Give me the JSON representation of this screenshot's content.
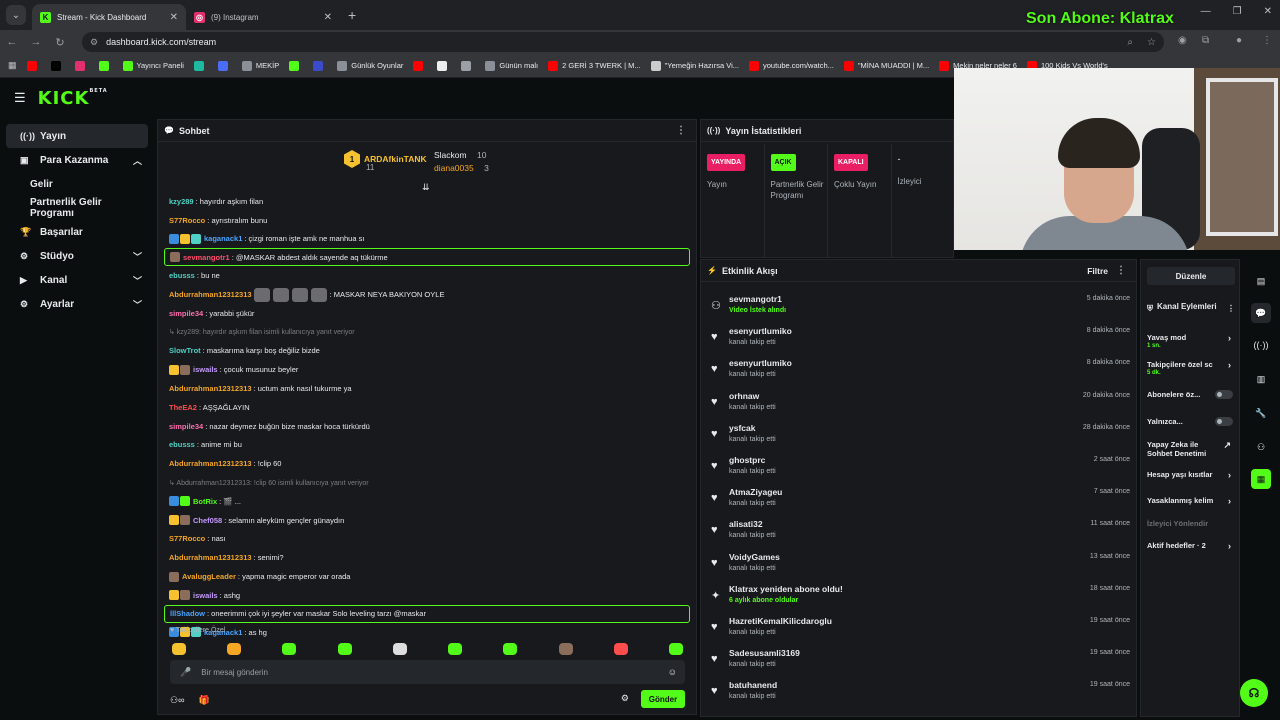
{
  "browser": {
    "tabs": [
      {
        "title": "Stream - Kick Dashboard",
        "icon": "K"
      },
      {
        "title": "(9) Instagram",
        "icon": "◎"
      }
    ],
    "url": "dashboard.kick.com/stream",
    "overlay_text": "Son Abone: Klatrax",
    "bookmarks": [
      {
        "label": "",
        "color": "#ff0000",
        "icon": "youtube-icon"
      },
      {
        "label": "",
        "color": "#000000",
        "icon": "x-icon"
      },
      {
        "label": "",
        "color": "#e1306c",
        "icon": "instagram-icon"
      },
      {
        "label": "",
        "color": "#53fc18",
        "icon": "kick-icon"
      },
      {
        "label": "Yayıncı Paneli",
        "color": "#53fc18",
        "icon": "kick-icon"
      },
      {
        "label": "",
        "color": "#1db9a0",
        "icon": "app-icon"
      },
      {
        "label": "",
        "color": "#4a6cf7",
        "icon": "arrow-icon"
      },
      {
        "label": "MEKİP",
        "color": "#8a8f98",
        "icon": "folder-icon"
      },
      {
        "label": "",
        "color": "#53fc18",
        "icon": "kick-icon"
      },
      {
        "label": "",
        "color": "#3b4cca",
        "icon": "app-icon"
      },
      {
        "label": "Günlük Oyunlar",
        "color": "#8a8f98",
        "icon": "folder-icon"
      },
      {
        "label": "",
        "color": "#ff0000",
        "icon": "youtube-icon"
      },
      {
        "label": "",
        "color": "#eeeeee",
        "icon": "game-icon"
      },
      {
        "label": "",
        "color": "#9aa0a6",
        "icon": "globe-icon"
      },
      {
        "label": "Günün malı",
        "color": "#8a8f98",
        "icon": "folder-icon"
      },
      {
        "label": "2 GERİ 3 TWERK | M...",
        "color": "#ff0000",
        "icon": "youtube-icon"
      },
      {
        "label": "\"Yemeğin Hazırsa Vi...",
        "color": "#cccccc",
        "icon": "globe-icon"
      },
      {
        "label": "youtube.com/watch...",
        "color": "#ff0000",
        "icon": "youtube-icon"
      },
      {
        "label": "\"MİNA MUADDI | M...",
        "color": "#ff0000",
        "icon": "youtube-icon"
      },
      {
        "label": "Mekin neler neler 6",
        "color": "#ff0000",
        "icon": "youtube-icon"
      },
      {
        "label": "100 Kids Vs World's",
        "color": "#ff0000",
        "icon": "youtube-icon"
      }
    ]
  },
  "sidebar": {
    "items": [
      {
        "label": "Yayın",
        "icon": "broadcast-icon",
        "active": true
      },
      {
        "label": "Para Kazanma",
        "icon": "money-icon",
        "expanded": true
      },
      {
        "label": "Gelir",
        "sub": true
      },
      {
        "label": "Partnerlik Gelir Programı",
        "sub": true
      },
      {
        "label": "Başarılar",
        "icon": "trophy-icon"
      },
      {
        "label": "Stüdyo",
        "icon": "studio-icon",
        "chevron": true
      },
      {
        "label": "Kanal",
        "icon": "channel-icon",
        "chevron": true
      },
      {
        "label": "Ayarlar",
        "icon": "settings-icon",
        "chevron": true
      }
    ]
  },
  "chat": {
    "title": "Sohbet",
    "pinned": {
      "top_name": "ARDAfkinTANK",
      "top_count": "11",
      "top_rank": "1",
      "second_name": "Slackom",
      "second_count": "10",
      "third_name": "diana0035",
      "third_count": "3"
    },
    "messages": [
      {
        "user": "kzy289",
        "color": "#4fd1c5",
        "text": ": hayırdır aşkım filan",
        "badges": []
      },
      {
        "user": "S77Rocco",
        "color": "#f5a623",
        "text": ": ayrıstıralım bunu",
        "badges": []
      },
      {
        "user": "kaganack1",
        "color": "#4aa3ff",
        "text": ": çizgi roman işte amk ne manhua sı",
        "badges": [
          "#3a8dde",
          "#f5c12e",
          "#4fd1c5"
        ]
      },
      {
        "user": "sevmangotr1",
        "color": "#ff4d6d",
        "text": ": @MASKAR abdest aldık sayende aq tükürme",
        "badges": [
          "#8a6d5a"
        ],
        "highlight": true
      },
      {
        "user": "ebusss",
        "color": "#4fd1c5",
        "text": ": bu ne",
        "badges": []
      },
      {
        "user": "Abdurrahman12312313",
        "color": "#f5a623",
        "text": ": MASKAR NEYA BAKIYON OYLE",
        "badges": [],
        "emotes": 4
      },
      {
        "user": "simpile34",
        "color": "#ff6fb0",
        "text": ": yarabbi şükür",
        "badges": []
      },
      {
        "user": "",
        "color": "#7a7d80",
        "text": "↳ kzy289: hayırdır aşkım filan isimli kullanıcıya yanıt veriyor",
        "badges": [],
        "reply": true
      },
      {
        "user": "SlowTrot",
        "color": "#4fd1c5",
        "text": ": maskarıma karşı boş değiliz bizde",
        "badges": []
      },
      {
        "user": "iswails",
        "color": "#c59aff",
        "text": ": çocuk musunuz beyler",
        "badges": [
          "#f5c12e",
          "#8a6d5a"
        ]
      },
      {
        "user": "Abdurrahman12312313",
        "color": "#f5a623",
        "text": ": uctum amk nasıl tukurme ya",
        "badges": []
      },
      {
        "user": "TheEA2",
        "color": "#ff4d4d",
        "text": ": AŞŞAĞLAYIN",
        "badges": []
      },
      {
        "user": "simpile34",
        "color": "#ff6fb0",
        "text": ": nazar deymez buğün bize maskar hoca türkürdü",
        "badges": []
      },
      {
        "user": "ebusss",
        "color": "#4fd1c5",
        "text": ": anime mi bu",
        "badges": []
      },
      {
        "user": "Abdurrahman12312313",
        "color": "#f5a623",
        "text": ": !clip 60",
        "badges": []
      },
      {
        "user": "",
        "color": "#7a7d80",
        "text": "↳ Abdurrahman12312313: !clip 60 isimli kullanıcıya yanıt veriyor",
        "badges": [],
        "reply": true
      },
      {
        "user": "BotRix",
        "color": "#53fc18",
        "text": ": 🎬 ...",
        "badges": [
          "#3a8dde",
          "#53fc18"
        ]
      },
      {
        "user": "Chef058",
        "color": "#c59aff",
        "text": ": selamın aleyküm gençler günaydın",
        "badges": [
          "#f5c12e",
          "#8a6d5a"
        ]
      },
      {
        "user": "S77Rocco",
        "color": "#f5a623",
        "text": ": nası",
        "badges": []
      },
      {
        "user": "Abdurrahman12312313",
        "color": "#f5a623",
        "text": ": senimi?",
        "badges": []
      },
      {
        "user": "AvaluggLeader",
        "color": "#f5a623",
        "text": ": yapma magic emperor var orada",
        "badges": [
          "#8a6d5a"
        ]
      },
      {
        "user": "iswails",
        "color": "#c59aff",
        "text": ": ashg",
        "badges": [
          "#f5c12e",
          "#8a6d5a"
        ]
      },
      {
        "user": "lllShadow",
        "color": "#4aa3ff",
        "text": ": oneerimmi çok iyi şeyler var maskar Solo leveling tarzı @maskar",
        "badges": [],
        "highlight": true
      },
      {
        "user": "kaganack1",
        "color": "#4aa3ff",
        "text": ": as hg",
        "badges": [
          "#3a8dde",
          "#f5c12e",
          "#4fd1c5"
        ]
      }
    ],
    "follower_note": "♥ Takipçilere Özel",
    "input_placeholder": "Bir mesaj gönderin",
    "send_label": "Gönder"
  },
  "stats": {
    "title": "Yayın İstatistikleri",
    "items": [
      {
        "pill": "YAYINDA",
        "pill_color": "#e91e63",
        "label": "Yayın"
      },
      {
        "pill": "AÇIK",
        "pill_color": "#53fc18",
        "label": "Partnerlik Gelir Programı"
      },
      {
        "pill": "KAPALI",
        "pill_color": "#e91e63",
        "label": "Çoklu Yayın"
      },
      {
        "value": "-",
        "label": "İzleyici"
      }
    ]
  },
  "events": {
    "title": "Etkinlik Akışı",
    "filter_label": "Filtre",
    "items": [
      {
        "name": "sevmangotr1",
        "desc": "Video İstek alındı",
        "time": "5 dakika önce",
        "icon": "people-icon",
        "green": true
      },
      {
        "name": "esenyurtlumiko",
        "desc": "kanalı takip etti",
        "time": "8 dakika önce",
        "icon": "heart-icon"
      },
      {
        "name": "esenyurtlumiko",
        "desc": "kanalı takip etti",
        "time": "8 dakika önce",
        "icon": "heart-icon"
      },
      {
        "name": "orhnaw",
        "desc": "kanalı takip etti",
        "time": "20 dakika önce",
        "icon": "heart-icon"
      },
      {
        "name": "ysfcak",
        "desc": "kanalı takip etti",
        "time": "28 dakika önce",
        "icon": "heart-icon"
      },
      {
        "name": "ghostprc",
        "desc": "kanalı takip etti",
        "time": "2 saat önce",
        "icon": "heart-icon"
      },
      {
        "name": "AtmaZiyageu",
        "desc": "kanalı takip etti",
        "time": "7 saat önce",
        "icon": "heart-icon"
      },
      {
        "name": "alisati32",
        "desc": "kanalı takip etti",
        "time": "11 saat önce",
        "icon": "heart-icon"
      },
      {
        "name": "VoidyGames",
        "desc": "kanalı takip etti",
        "time": "13 saat önce",
        "icon": "heart-icon"
      },
      {
        "name": "Klatrax yeniden abone oldu!",
        "desc": "6 aylık abone oldular",
        "time": "18 saat önce",
        "icon": "star-icon",
        "green": true
      },
      {
        "name": "HazretiKemalKilicdaroglu",
        "desc": "kanalı takip etti",
        "time": "19 saat önce",
        "icon": "heart-icon"
      },
      {
        "name": "Sadesusamli3169",
        "desc": "kanalı takip etti",
        "time": "19 saat önce",
        "icon": "heart-icon"
      },
      {
        "name": "batuhanend",
        "desc": "kanalı takip etti",
        "time": "19 saat önce",
        "icon": "heart-icon"
      }
    ]
  },
  "mod": {
    "edit_label": "Düzenle",
    "title": "Kanal Eylemleri",
    "items": [
      {
        "label": "Yavaş mod",
        "sub": "1 sn.",
        "type": "arrow"
      },
      {
        "label": "Takipçilere özel sc",
        "sub": "5 dk.",
        "type": "arrow"
      },
      {
        "label": "Abonelere öz...",
        "type": "toggle"
      },
      {
        "label": "Yalnızca...",
        "type": "toggle"
      },
      {
        "label": "Yapay Zeka ile Sohbet Denetimi",
        "type": "ext"
      },
      {
        "label": "Hesap yaşı kısıtlar",
        "type": "arrow"
      },
      {
        "label": "Yasaklanmış kelim",
        "type": "arrow"
      },
      {
        "label": "İzleyici Yönlendir",
        "type": "dim"
      },
      {
        "label": "Aktif hedefler · 2",
        "type": "arrow"
      }
    ]
  }
}
